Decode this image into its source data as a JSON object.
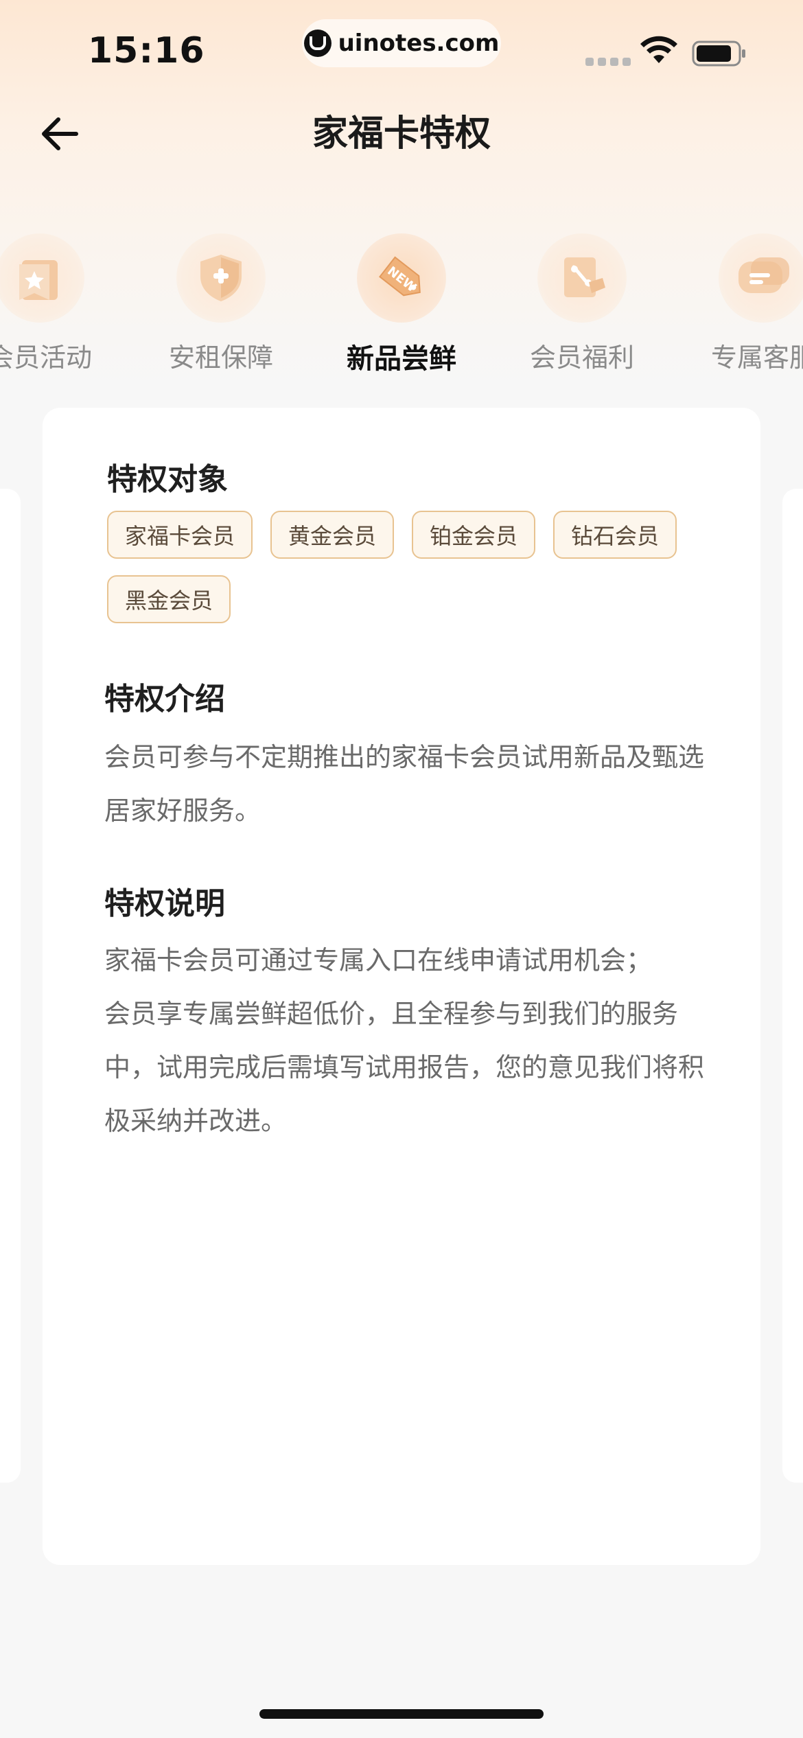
{
  "status_bar": {
    "time": "15:16",
    "url": "uinotes.com"
  },
  "header": {
    "title": "家福卡特权"
  },
  "tabs": [
    {
      "label": "会员活动",
      "icon": "star-bookmark-icon",
      "active": false
    },
    {
      "label": "安租保障",
      "icon": "shield-plus-icon",
      "active": false
    },
    {
      "label": "新品尝鲜",
      "icon": "new-tag-icon",
      "active": true
    },
    {
      "label": "会员福利",
      "icon": "percent-coupon-icon",
      "active": false
    },
    {
      "label": "专属客服",
      "icon": "chat-bubble-icon",
      "active": false
    }
  ],
  "card": {
    "target_title": "特权对象",
    "tags": [
      "家福卡会员",
      "黄金会员",
      "铂金会员",
      "钻石会员",
      "黑金会员"
    ],
    "intro_title": "特权介绍",
    "intro_text": "会员可参与不定期推出的家福卡会员试用新品及甄选居家好服务。",
    "desc_title": "特权说明",
    "desc_lines": [
      "家福卡会员可通过专属入口在线申请试用机会；",
      "会员享专属尝鲜超低价，且全程参与到我们的服务中，试用完成后需填写试用报告，您的意见我们将积极采纳并改进。"
    ]
  },
  "colors": {
    "accent_gold": "#e8c391",
    "tag_bg": "#fdf6ec",
    "header_gradient_top": "#fde7d3"
  }
}
